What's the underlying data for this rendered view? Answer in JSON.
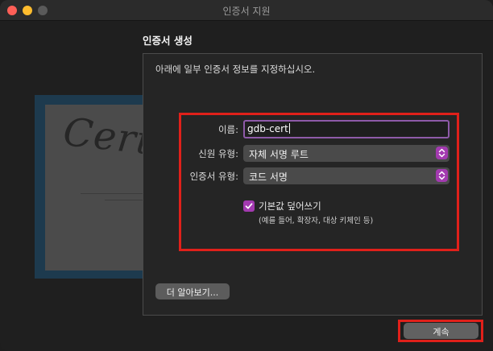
{
  "window": {
    "title": "인증서 지원"
  },
  "section_title": "인증서 생성",
  "intro_text": "아래에 일부 인증서 정보를 지정하십시오.",
  "certificate_art": {
    "script_word": "Certificate"
  },
  "form": {
    "name": {
      "label": "이름:",
      "value": "gdb-cert"
    },
    "identity_type": {
      "label": "신원 유형:",
      "selected": "자체 서명 루트"
    },
    "certificate_type": {
      "label": "인증서 유형:",
      "selected": "코드 서명"
    },
    "override_defaults": {
      "checked": true,
      "label": "기본값 덮어쓰기",
      "sublabel": "(예를 들어, 확장자, 대상 키체인 등)"
    }
  },
  "buttons": {
    "learn_more": "더 알아보기...",
    "continue": "계속"
  },
  "colors": {
    "accent": "#a33ab0",
    "highlight_box": "#e0201a",
    "focus_ring": "#8e5aa8"
  }
}
